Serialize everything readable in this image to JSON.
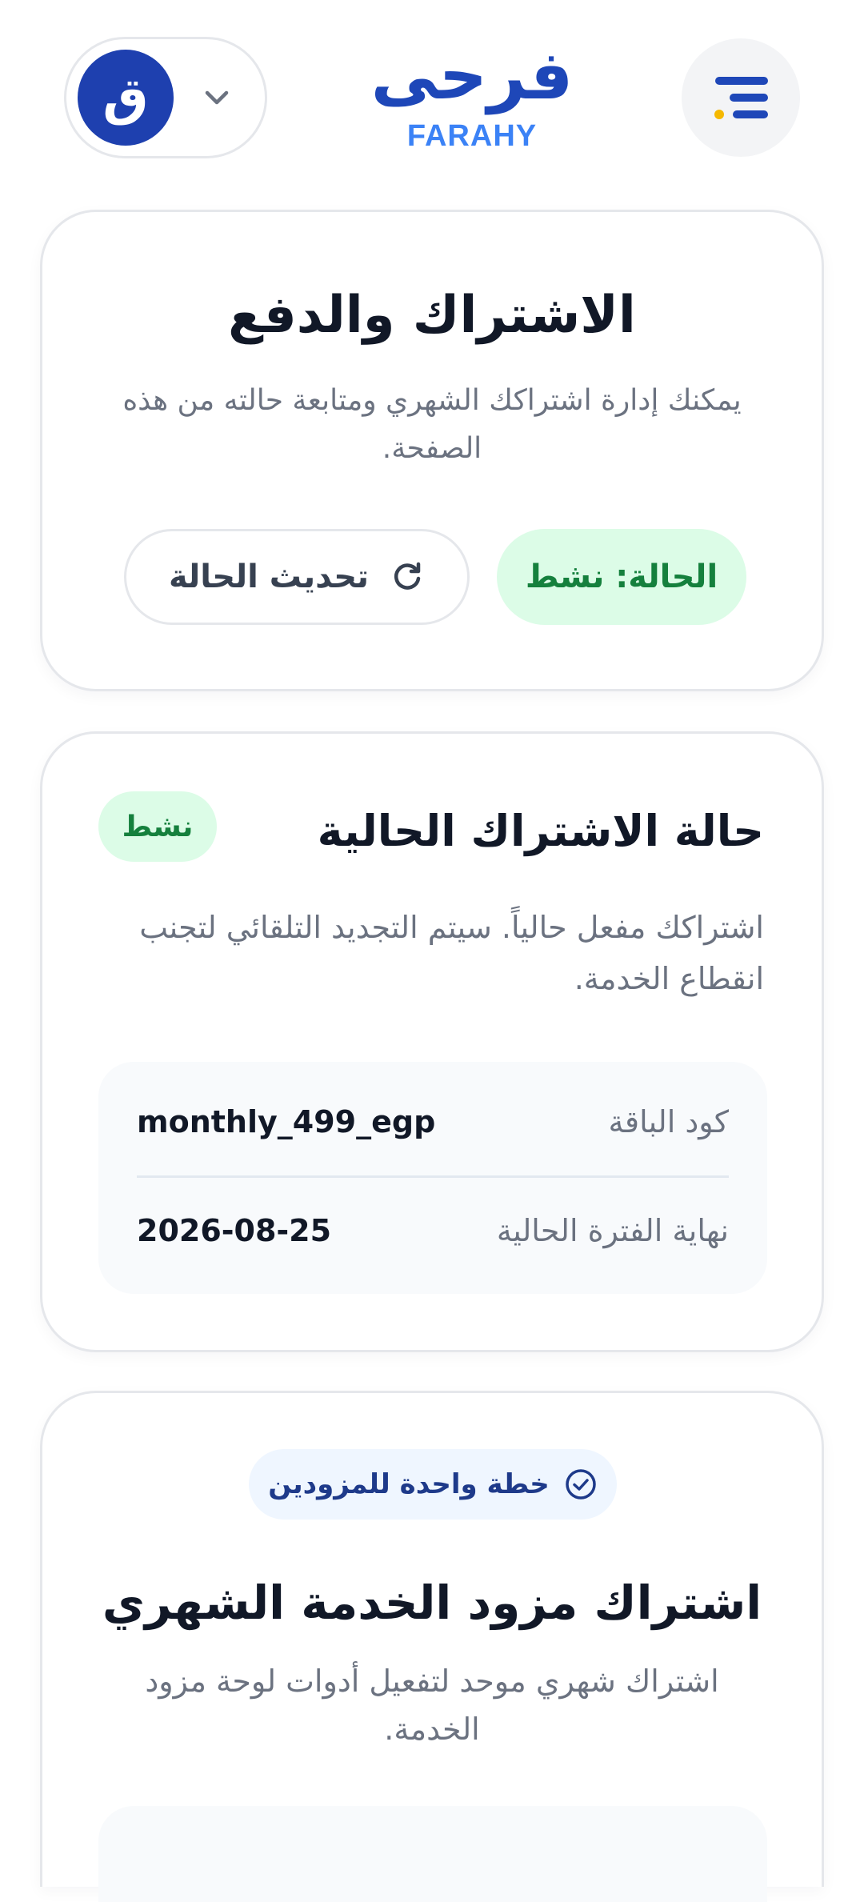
{
  "header": {
    "logo_ar": "فرحى",
    "logo_en": "FARAHY",
    "avatar_letter": "ق",
    "menu_icon": "menu-icon",
    "chevron_icon": "chevron-down-icon",
    "brand_color": "#1e47b8",
    "accent_dot_color": "#f5b800"
  },
  "subscription": {
    "title": "الاشتراك والدفع",
    "subtitle": "يمكنك إدارة اشتراكك الشهري ومتابعة حالته من هذه الصفحة.",
    "status_label": "الحالة: نشط",
    "refresh_label": "تحديث الحالة",
    "refresh_icon": "refresh-icon"
  },
  "current": {
    "title": "حالة الاشتراك الحالية",
    "badge": "نشط",
    "description": "اشتراكك مفعل حالياً. سيتم التجديد التلقائي لتجنب انقطاع الخدمة.",
    "rows": [
      {
        "label": "كود الباقة",
        "value": "monthly_499_egp"
      },
      {
        "label": "نهاية الفترة الحالية",
        "value": "2026-08-25"
      }
    ]
  },
  "plan": {
    "chip_label": "خطة واحدة للمزودين",
    "chip_icon": "check-circle-icon",
    "title": "اشتراك مزود الخدمة الشهري",
    "subtitle": "اشتراك شهري موحد لتفعيل أدوات لوحة مزود الخدمة."
  }
}
